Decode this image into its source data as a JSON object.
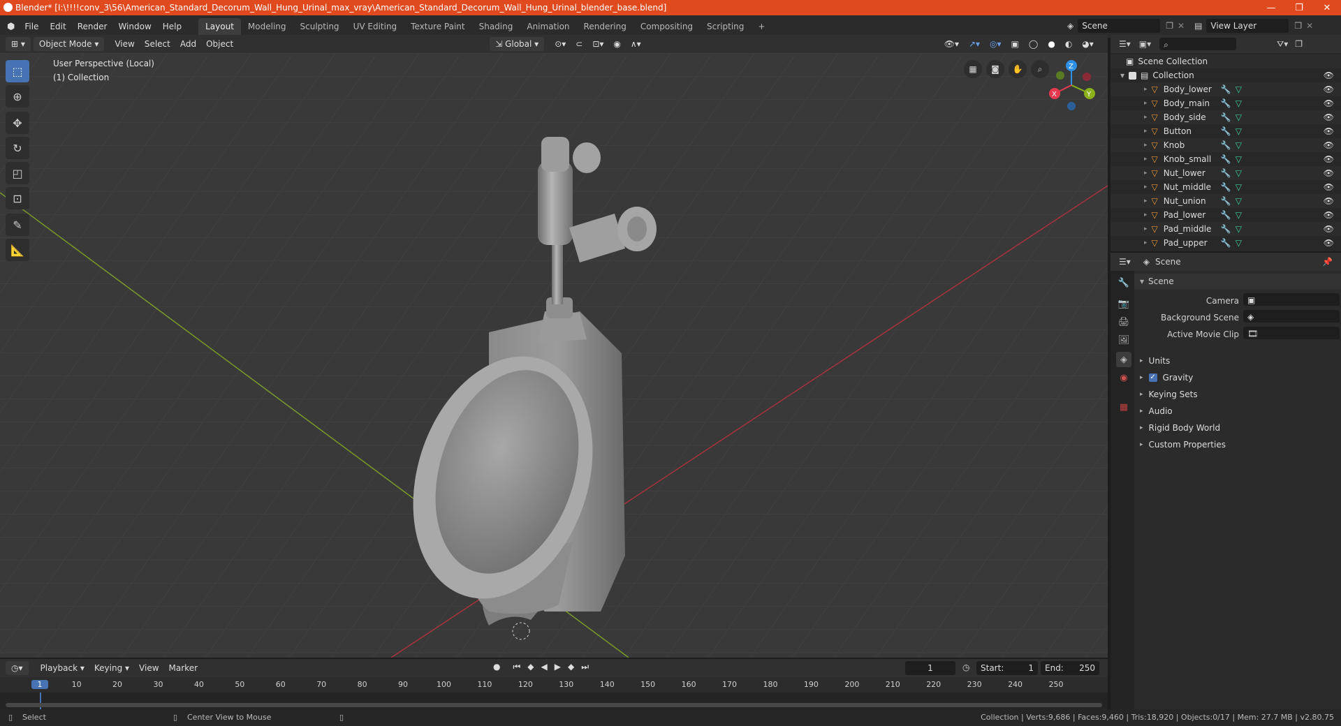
{
  "window": {
    "title": "Blender* [I:\\!!!!conv_3\\56\\American_Standard_Decorum_Wall_Hung_Urinal_max_vray\\American_Standard_Decorum_Wall_Hung_Urinal_blender_base.blend]"
  },
  "menu": [
    "File",
    "Edit",
    "Render",
    "Window",
    "Help"
  ],
  "workspaces": [
    "Layout",
    "Modeling",
    "Sculpting",
    "UV Editing",
    "Texture Paint",
    "Shading",
    "Animation",
    "Rendering",
    "Compositing",
    "Scripting"
  ],
  "scene_field": "Scene",
  "viewlayer_field": "View Layer",
  "viewport_header": {
    "mode": "Object Mode",
    "menus": [
      "View",
      "Select",
      "Add",
      "Object"
    ],
    "orientation": "Global"
  },
  "viewport": {
    "perspective": "User Perspective (Local)",
    "collection": "(1) Collection",
    "axes": {
      "x": "X",
      "y": "Y",
      "z": "Z"
    }
  },
  "outliner": {
    "root": "Scene Collection",
    "collection": "Collection",
    "objects": [
      "Body_lower",
      "Body_main",
      "Body_side",
      "Button",
      "Knob",
      "Knob_small",
      "Nut_lower",
      "Nut_middle",
      "Nut_union",
      "Pad_lower",
      "Pad_middle",
      "Pad_upper"
    ]
  },
  "properties": {
    "header": "Scene",
    "panel": "Scene",
    "fields": [
      {
        "label": "Camera"
      },
      {
        "label": "Background Scene"
      },
      {
        "label": "Active Movie Clip"
      }
    ],
    "sections": [
      {
        "label": "Units"
      },
      {
        "label": "Gravity",
        "checked": true
      },
      {
        "label": "Keying Sets"
      },
      {
        "label": "Audio"
      },
      {
        "label": "Rigid Body World"
      },
      {
        "label": "Custom Properties"
      }
    ]
  },
  "timeline": {
    "menus": [
      "Playback",
      "Keying",
      "View",
      "Marker"
    ],
    "current_frame": "1",
    "start_label": "Start:",
    "start": "1",
    "end_label": "End:",
    "end": "250",
    "ticks": [
      "1",
      "10",
      "20",
      "30",
      "40",
      "50",
      "60",
      "70",
      "80",
      "90",
      "100",
      "110",
      "120",
      "130",
      "140",
      "150",
      "160",
      "170",
      "180",
      "190",
      "200",
      "210",
      "220",
      "230",
      "240",
      "250"
    ]
  },
  "status": {
    "left": "Select",
    "middle": "Center View to Mouse",
    "right": "Collection | Verts:9,686 | Faces:9,460 | Tris:18,920 | Objects:0/17 | Mem: 27.7 MB | v2.80.75"
  },
  "colors": {
    "accent": "#4772b3",
    "titlebar": "#e04a1e",
    "x_axis": "#e8394f",
    "y_axis": "#8bb21a",
    "z_axis": "#2e8fe6"
  }
}
